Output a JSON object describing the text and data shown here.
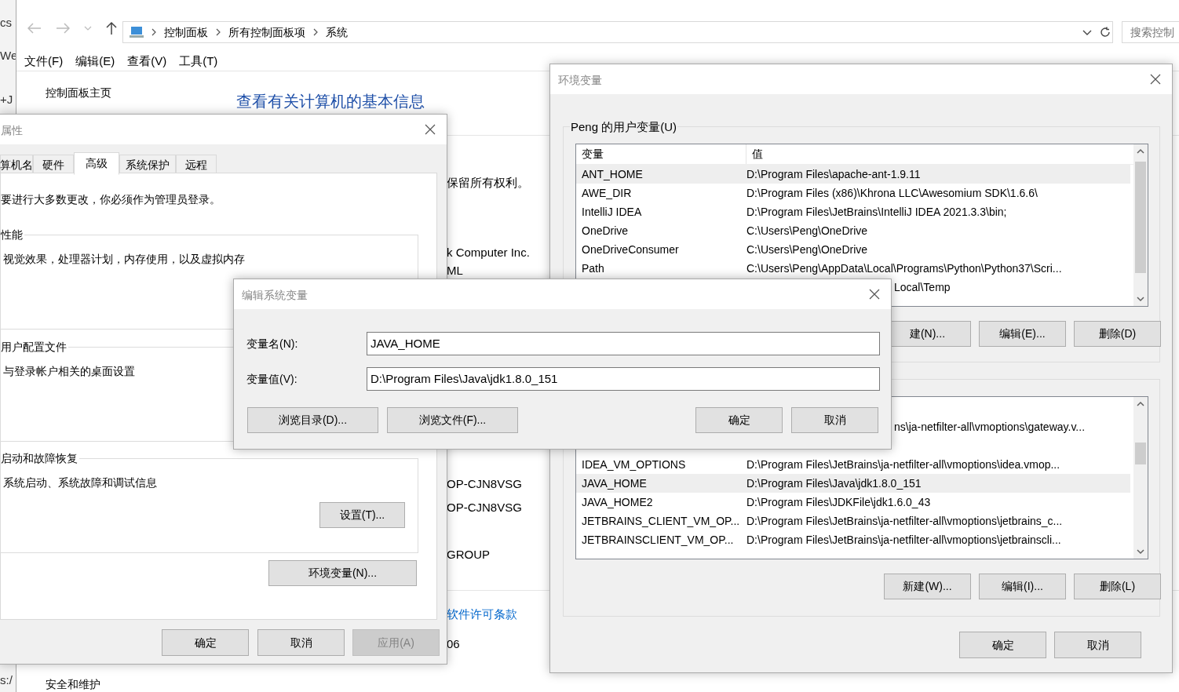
{
  "background_window": {
    "fragments": [
      "cs",
      "We",
      "+J",
      "s:/"
    ]
  },
  "control_panel": {
    "breadcrumbs": [
      "控制面板",
      "所有控制面板项",
      "系统"
    ],
    "search": {
      "placeholder": "搜索控制"
    },
    "menu": [
      "文件(F)",
      "编辑(E)",
      "查看(V)",
      "工具(T)"
    ],
    "sidebar_link": "控制面板主页",
    "heading": "查看有关计算机的基本信息",
    "fragments": [
      {
        "kind": "text",
        "text": "保留所有权利。"
      },
      {
        "kind": "text",
        "text": "k Computer Inc."
      },
      {
        "kind": "text",
        "text": "ML"
      },
      {
        "kind": "text",
        "text": "OP-CJN8VSG"
      },
      {
        "kind": "text",
        "text": "OP-CJN8VSG"
      },
      {
        "kind": "text",
        "text": "GROUP"
      },
      {
        "kind": "link",
        "text": "软件许可条款"
      },
      {
        "kind": "text",
        "text": "06"
      }
    ],
    "sidebar_bottom": "安全和维护"
  },
  "system_properties": {
    "title": "属性",
    "tabs": [
      {
        "label": "算机名",
        "selected": false
      },
      {
        "label": "硬件",
        "selected": false
      },
      {
        "label": "高级",
        "selected": true
      },
      {
        "label": "系统保护",
        "selected": false
      },
      {
        "label": "远程",
        "selected": false
      }
    ],
    "notice": "要进行大多数更改，你必须作为管理员登录。",
    "groups": [
      {
        "label": "性能",
        "description": "视觉效果，处理器计划，内存使用，以及虚拟内存"
      },
      {
        "label": "用户配置文件",
        "description": "与登录帐户相关的桌面设置"
      },
      {
        "label": "启动和故障恢复",
        "description": "系统启动、系统故障和调试信息",
        "button": "设置(T)..."
      }
    ],
    "env_button": "环境变量(N)...",
    "buttons": [
      {
        "label": "确定",
        "disabled": false
      },
      {
        "label": "取消",
        "disabled": false
      },
      {
        "label": "应用(A)",
        "disabled": true
      }
    ]
  },
  "environment_variables": {
    "title": "环境变量",
    "user_vars": {
      "label": "Peng 的用户变量(U)",
      "columns": [
        "变量",
        "值"
      ],
      "rows": [
        {
          "name": "ANT_HOME",
          "value": "D:\\Program Files\\apache-ant-1.9.11",
          "selected": true
        },
        {
          "name": "AWE_DIR",
          "value": "D:\\Program Files (x86)\\Khrona LLC\\Awesomium SDK\\1.6.6\\",
          "selected": false
        },
        {
          "name": "IntelliJ IDEA",
          "value": "D:\\Program Files\\JetBrains\\IntelliJ IDEA 2021.3.3\\bin;",
          "selected": false
        },
        {
          "name": "OneDrive",
          "value": "C:\\Users\\Peng\\OneDrive",
          "selected": false
        },
        {
          "name": "OneDriveConsumer",
          "value": "C:\\Users\\Peng\\OneDrive",
          "selected": false
        },
        {
          "name": "Path",
          "value": "C:\\Users\\Peng\\AppData\\Local\\Programs\\Python\\Python37\\Scri...",
          "selected": false
        },
        {
          "value": "Local\\Temp",
          "selected": false
        }
      ],
      "buttons": [
        "建(N)...",
        "编辑(E)...",
        "删除(D)"
      ]
    },
    "system_vars": {
      "rows": [
        {
          "value": "ns\\ja-netfilter-all\\vmoptions\\gateway.v...",
          "selected": false
        },
        {
          "name": "IDEA_VM_OPTIONS",
          "value": "D:\\Program Files\\JetBrains\\ja-netfilter-all\\vmoptions\\idea.vmop...",
          "selected": false
        },
        {
          "name": "JAVA_HOME",
          "value": "D:\\Program Files\\Java\\jdk1.8.0_151",
          "selected": true
        },
        {
          "name": "JAVA_HOME2",
          "value": "D:\\Program Files\\JDKFile\\jdk1.6.0_43",
          "selected": false
        },
        {
          "name": "JETBRAINS_CLIENT_VM_OP...",
          "value": "D:\\Program Files\\JetBrains\\ja-netfilter-all\\vmoptions\\jetbrains_c...",
          "selected": false
        },
        {
          "name": "JETBRAINSCLIENT_VM_OP...",
          "value": "D:\\Program Files\\JetBrains\\ja-netfilter-all\\vmoptions\\jetbrainscli...",
          "selected": false
        }
      ],
      "buttons": [
        "新建(W)...",
        "编辑(I)...",
        "删除(L)"
      ]
    },
    "buttons": [
      "确定",
      "取消"
    ]
  },
  "edit_dialog": {
    "title": "编辑系统变量",
    "fields": [
      {
        "label": "变量名(N):",
        "value": "JAVA_HOME"
      },
      {
        "label": "变量值(V):",
        "value": "D:\\Program Files\\Java\\jdk1.8.0_151"
      }
    ],
    "buttons": [
      "浏览目录(D)...",
      "浏览文件(F)...",
      "确定",
      "取消"
    ]
  }
}
